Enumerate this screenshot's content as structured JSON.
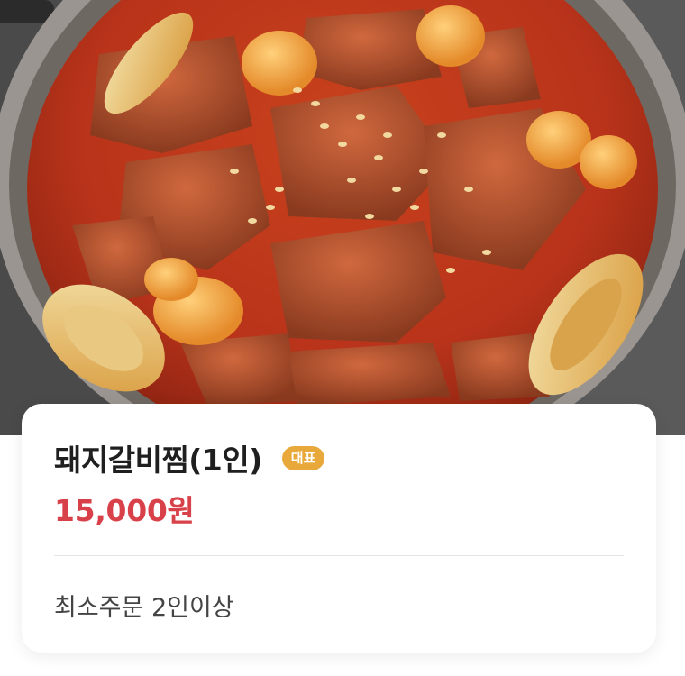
{
  "product": {
    "image_subject": "Braised pork ribs in red sauce",
    "name": "돼지갈비찜(1인)",
    "badge": "대표",
    "price": "15,000원",
    "min_order": "최소주문 2인이상"
  },
  "colors": {
    "price": "#d9414a",
    "badge": "#e8a93a",
    "title": "#1f1f1f"
  }
}
